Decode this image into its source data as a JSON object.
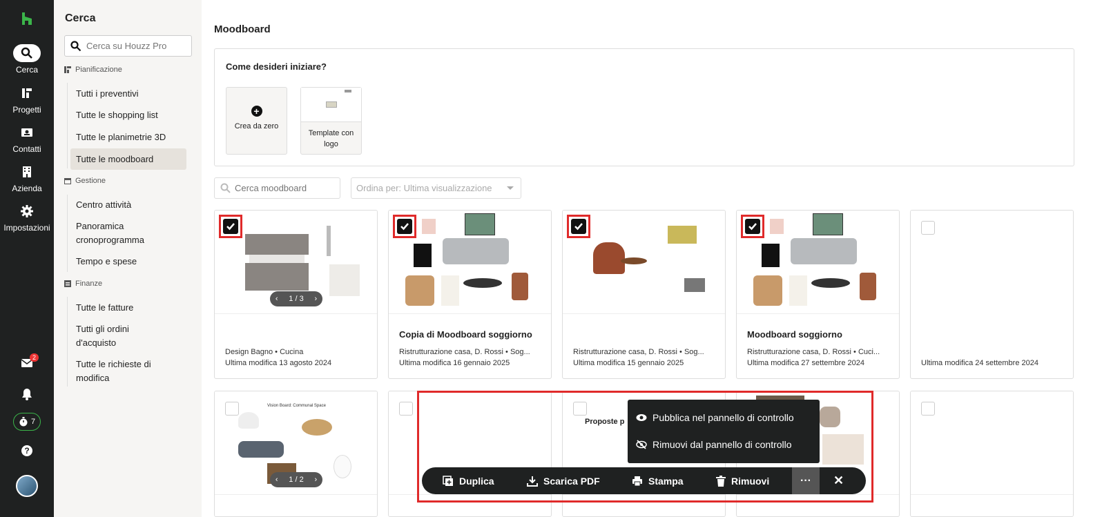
{
  "rail": {
    "items": [
      {
        "label": "Cerca",
        "icon": "search-icon"
      },
      {
        "label": "Progetti",
        "icon": "projects-icon"
      },
      {
        "label": "Contatti",
        "icon": "contacts-icon"
      },
      {
        "label": "Azienda",
        "icon": "building-icon"
      },
      {
        "label": "Impostazioni",
        "icon": "gear-icon"
      }
    ],
    "inbox_badge": "2",
    "timer_count": "7"
  },
  "nav": {
    "title": "Cerca",
    "search_placeholder": "Cerca su Houzz Pro",
    "groups": [
      {
        "label": "Pianificazione",
        "items": [
          "Tutti i preventivi",
          "Tutte le shopping list",
          "Tutte le planimetrie 3D",
          "Tutte le moodboard"
        ]
      },
      {
        "label": "Gestione",
        "items": [
          "Centro attività",
          "Panoramica cronoprogramma",
          "Tempo e spese"
        ]
      },
      {
        "label": "Finanze",
        "items": [
          "Tutte le fatture",
          "Tutti gli ordini d'acquisto",
          "Tutte le richieste di modifica"
        ]
      }
    ],
    "active_item": "Tutte le moodboard"
  },
  "main": {
    "title": "Moodboard",
    "start": {
      "question": "Come desideri iniziare?",
      "create_label": "Crea da zero",
      "template_label": "Template con logo"
    },
    "filter": {
      "search_placeholder": "Cerca moodboard",
      "sort_label": "Ordina per: Ultima visualizzazione"
    },
    "cards": [
      {
        "title": "",
        "sub": "Design Bagno • Cucina",
        "modified": "Ultima modifica 13 agosto 2024",
        "checked": true,
        "pager": "1 / 3"
      },
      {
        "title": "Copia di Moodboard soggiorno",
        "sub": "Ristrutturazione casa, D. Rossi • Sog...",
        "modified": "Ultima modifica 16 gennaio 2025",
        "checked": true
      },
      {
        "title": "",
        "sub": "Ristrutturazione casa, D. Rossi • Sog...",
        "modified": "Ultima modifica 15 gennaio 2025",
        "checked": true
      },
      {
        "title": "Moodboard soggiorno",
        "sub": "Ristrutturazione casa, D. Rossi • Cuci...",
        "modified": "Ultima modifica 27 settembre 2024",
        "checked": true
      },
      {
        "title": "",
        "sub": "",
        "modified": "Ultima modifica 24 settembre 2024",
        "checked": false
      }
    ],
    "row2": {
      "card1_heading": "Vision Board: Communal Space",
      "card1_pager": "1 / 2",
      "card3_heading": "Proposte p"
    }
  },
  "actions": {
    "duplicate": "Duplica",
    "download_pdf": "Scarica PDF",
    "print": "Stampa",
    "remove": "Rimuovi",
    "more": "···",
    "close": "✕"
  },
  "popup": {
    "publish": "Pubblica nel pannello di controllo",
    "unpublish": "Rimuovi dal pannello di controllo"
  },
  "colors": {
    "brand": "#3bb54a",
    "rail": "#1f2121",
    "highlight": "#e02a2a"
  }
}
